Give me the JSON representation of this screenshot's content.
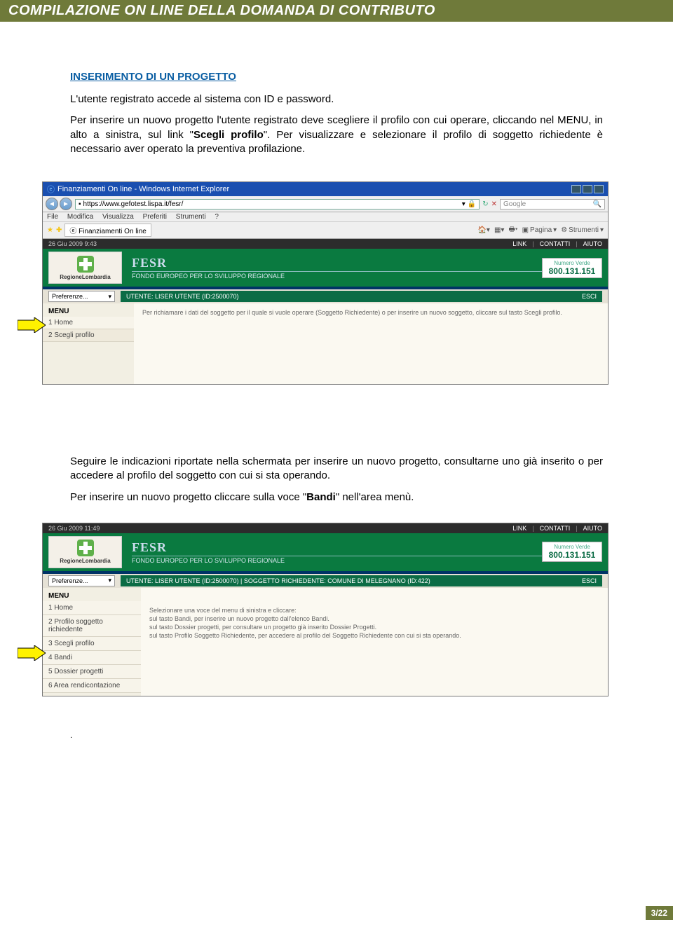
{
  "header": "COMPILAZIONE ON LINE DELLA DOMANDA DI CONTRIBUTO",
  "sectionTitle": "INSERIMENTO DI UN PROGETTO",
  "para1": "L'utente registrato accede al sistema con ID e password.",
  "para2a": "Per inserire un nuovo progetto l'utente registrato deve scegliere il profilo con cui operare, cliccando nel MENU, in alto a sinistra, sul link \"",
  "para2bold": "Scegli profilo",
  "para2b": "\". Per visualizzare e selezionare il profilo di soggetto richiedente è necessario aver operato la preventiva profilazione.",
  "shot1": {
    "ieTitle": "Finanziamenti On line - Windows Internet Explorer",
    "url": "https://www.gefotest.lispa.it/fesr/",
    "searchPlaceholder": "Google",
    "menuFile": "File",
    "menuModifica": "Modifica",
    "menuVisualizza": "Visualizza",
    "menuPreferiti": "Preferiti",
    "menuStrumenti": "Strumenti",
    "menuHelp": "?",
    "tabTitle": "Finanziamenti On line",
    "tbPagina": "Pagina",
    "tbStrumenti": "Strumenti",
    "datetime": "26 Giu 2009  9:43",
    "linkLink": "LINK",
    "linkContatti": "CONTATTI",
    "linkAiuto": "AIUTO",
    "logoText": "RegioneLombardia",
    "fesrTitle": "FESR",
    "fesrSub": "FONDO EUROPEO PER LO SVILUPPO REGIONALE",
    "verdeLabel": "Numero Verde",
    "verdeNum": "800.131.151",
    "prefLabel": "Preferenze...",
    "userStrip": "UTENTE:  LISER UTENTE (ID:2500070)",
    "esci": "ESCI",
    "menuTitle": "MENU",
    "menuHome": "1  Home",
    "menuScegli": "2  Scegli profilo",
    "hint": "Per richiamare i dati del soggetto per il quale si vuole operare (Soggetto Richiedente) o per inserire un nuovo soggetto, cliccare sul tasto Scegli profilo."
  },
  "para3": "Seguire le indicazioni riportate nella schermata per inserire un nuovo progetto, consultarne uno già inserito o per accedere al profilo del soggetto con cui si sta operando.",
  "para4a": "Per inserire un nuovo progetto cliccare sulla voce \"",
  "para4bold": "Bandi",
  "para4b": "\" nell'area menù.",
  "shot2": {
    "datetime": "26 Giu 2009 11:49",
    "linkLink": "LINK",
    "linkContatti": "CONTATTI",
    "linkAiuto": "AIUTO",
    "logoText": "RegioneLombardia",
    "fesrTitle": "FESR",
    "fesrSub": "FONDO EUROPEO PER LO SVILUPPO REGIONALE",
    "verdeLabel": "Numero Verde",
    "verdeNum": "800.131.151",
    "prefLabel": "Preferenze...",
    "userStrip": "UTENTE:  LISER UTENTE (ID:2500070)   |   SOGGETTO RICHIEDENTE:  COMUNE DI MELEGNANO (ID:422)",
    "esci": "ESCI",
    "menuTitle": "MENU",
    "m1": "1  Home",
    "m2": "2  Profilo soggetto richiedente",
    "m3": "3  Scegli profilo",
    "m4": "4  Bandi",
    "m5": "5  Dossier progetti",
    "m6": "6  Area rendicontazione",
    "hintLine1": "Selezionare una voce del menu di sinistra e cliccare:",
    "hintLine2": "sul tasto Bandi, per inserire un nuovo progetto dall'elenco Bandi.",
    "hintLine3": "sul tasto Dossier progetti, per consultare un progetto già inserito Dossier Progetti.",
    "hintLine4": "sul tasto Profilo Soggetto Richiedente, per accedere al profilo del Soggetto Richiedente con cui si sta operando."
  },
  "dot": ".",
  "pageNum": "3/22"
}
